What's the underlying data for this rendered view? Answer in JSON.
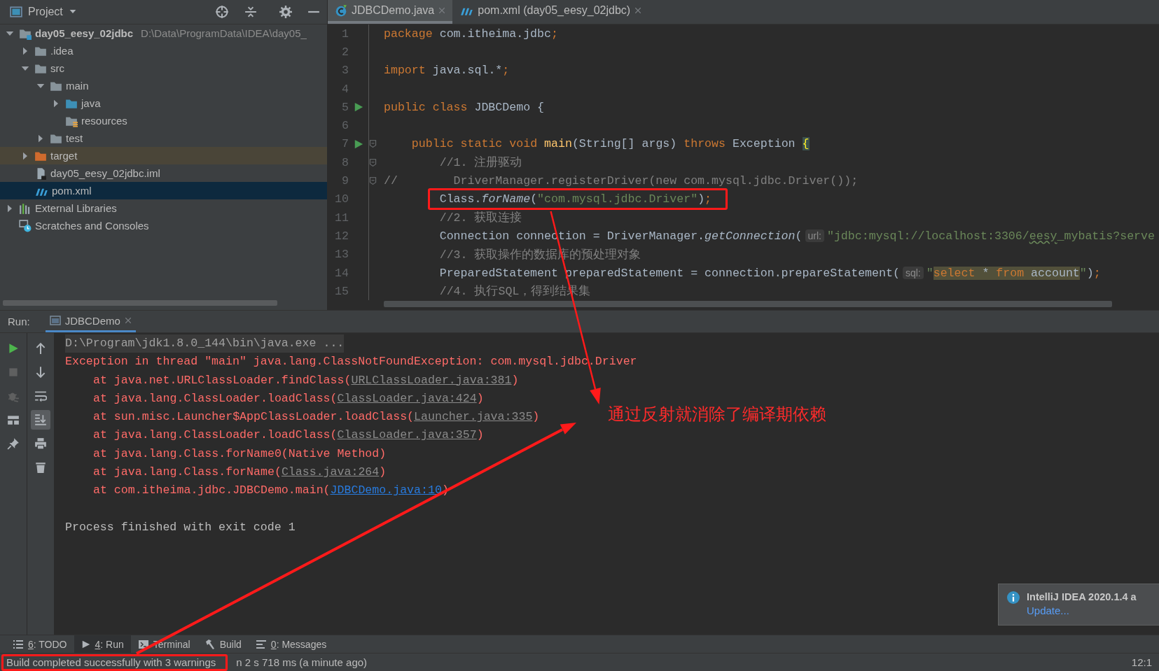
{
  "project_panel": {
    "title": "Project",
    "tree": [
      {
        "name": "day05_eesy_02jdbc",
        "path": "D:\\Data\\ProgramData\\IDEA\\day05_",
        "kind": "module",
        "expanded": true,
        "selected": false,
        "children": [
          {
            "name": ".idea",
            "kind": "folder",
            "expanded": false,
            "selected": false
          },
          {
            "name": "src",
            "kind": "folder",
            "expanded": true,
            "selected": false,
            "children": [
              {
                "name": "main",
                "kind": "folder",
                "expanded": true,
                "selected": false,
                "children": [
                  {
                    "name": "java",
                    "kind": "source-folder",
                    "expanded": false,
                    "selected": false
                  },
                  {
                    "name": "resources",
                    "kind": "resources-folder",
                    "selected": false
                  }
                ]
              },
              {
                "name": "test",
                "kind": "folder",
                "expanded": false,
                "selected": false
              }
            ]
          },
          {
            "name": "target",
            "kind": "excluded-folder",
            "expanded": false,
            "selected": false
          },
          {
            "name": "day05_eesy_02jdbc.iml",
            "kind": "iml-file",
            "selected": false
          },
          {
            "name": "pom.xml",
            "kind": "maven-file",
            "selected": true
          }
        ]
      },
      {
        "name": "External Libraries",
        "kind": "libraries",
        "expanded": false,
        "selected": false
      },
      {
        "name": "Scratches and Consoles",
        "kind": "scratches",
        "selected": false
      }
    ]
  },
  "editor": {
    "tabs": [
      {
        "label": "JDBCDemo.java",
        "kind": "java-class",
        "selected": true
      },
      {
        "label": "pom.xml (day05_eesy_02jdbc)",
        "kind": "maven",
        "selected": false
      }
    ],
    "lines": [
      {
        "number": "1",
        "boxed": false,
        "run_marker": false,
        "fold": false,
        "tokens": [
          {
            "kind": "keyword",
            "text": "package "
          },
          {
            "kind": "plain",
            "text": "com.itheima.jdbc"
          },
          {
            "kind": "keyword",
            "text": ";"
          }
        ]
      },
      {
        "number": "2",
        "boxed": false,
        "run_marker": false,
        "fold": false
      },
      {
        "number": "3",
        "boxed": false,
        "run_marker": false,
        "fold": false,
        "tokens": [
          {
            "kind": "keyword",
            "text": "import "
          },
          {
            "kind": "plain",
            "text": "java.sql.*"
          },
          {
            "kind": "keyword",
            "text": ";"
          }
        ]
      },
      {
        "number": "4",
        "boxed": false,
        "run_marker": false,
        "fold": false
      },
      {
        "number": "5",
        "boxed": false,
        "run_marker": true,
        "fold": false,
        "tokens": [
          {
            "kind": "keyword",
            "text": "public class "
          },
          {
            "kind": "plain",
            "text": "JDBCDemo {"
          }
        ]
      },
      {
        "number": "6",
        "boxed": false,
        "run_marker": false,
        "fold": false
      },
      {
        "number": "7",
        "boxed": false,
        "run_marker": true,
        "fold": true,
        "tokens": [
          {
            "kind": "keyword",
            "text": "    public static void "
          },
          {
            "kind": "method",
            "text": "main"
          },
          {
            "kind": "plain",
            "text": "(String[] args) "
          },
          {
            "kind": "keyword",
            "text": "throws "
          },
          {
            "kind": "plain",
            "text": "Exception "
          },
          {
            "kind": "brace-match",
            "text": "{"
          }
        ]
      },
      {
        "number": "8",
        "boxed": false,
        "run_marker": false,
        "fold": true,
        "tokens": [
          {
            "kind": "comment",
            "text": "        //1. 注册驱动"
          }
        ]
      },
      {
        "number": "9",
        "boxed": false,
        "run_marker": false,
        "fold": true,
        "tokens": [
          {
            "kind": "comment",
            "text": "//        DriverManager.registerDriver(new com.mysql.jdbc.Driver());"
          }
        ]
      },
      {
        "number": "10",
        "boxed": true,
        "run_marker": false,
        "fold": false,
        "tokens": [
          {
            "kind": "plain",
            "text": "        Class."
          },
          {
            "kind": "static-method",
            "text": "forName"
          },
          {
            "kind": "plain",
            "text": "("
          },
          {
            "kind": "string",
            "text": "\"com.mysql.jdbc.Driver\""
          },
          {
            "kind": "plain",
            "text": ")"
          },
          {
            "kind": "keyword",
            "text": ";"
          }
        ]
      },
      {
        "number": "11",
        "boxed": false,
        "run_marker": false,
        "fold": false,
        "tokens": [
          {
            "kind": "comment",
            "text": "        //2. 获取连接"
          }
        ]
      },
      {
        "number": "12",
        "boxed": false,
        "run_marker": false,
        "fold": false,
        "tokens": [
          {
            "kind": "plain",
            "text": "        Connection connection = DriverManager."
          },
          {
            "kind": "static-method",
            "text": "getConnection"
          },
          {
            "kind": "plain",
            "text": "("
          },
          {
            "kind": "hint",
            "text": "url:"
          },
          {
            "kind": "string",
            "text": "\"jdbc:mysql://localhost:3306/"
          },
          {
            "kind": "typo",
            "text": "eesy"
          },
          {
            "kind": "string",
            "text": "_mybatis?serve"
          }
        ]
      },
      {
        "number": "13",
        "boxed": false,
        "run_marker": false,
        "fold": false,
        "tokens": [
          {
            "kind": "comment",
            "text": "        //3. 获取操作的数据库的预处理对象"
          }
        ]
      },
      {
        "number": "14",
        "boxed": false,
        "run_marker": false,
        "fold": false,
        "tokens": [
          {
            "kind": "plain",
            "text": "        PreparedStatement preparedStatement = connection.prepareStatement("
          },
          {
            "kind": "hint",
            "text": "sql:"
          },
          {
            "kind": "string",
            "text": "\""
          },
          {
            "kind": "sql-keyword",
            "text": "select"
          },
          {
            "kind": "sql-text",
            "text": " * "
          },
          {
            "kind": "sql-keyword",
            "text": "from"
          },
          {
            "kind": "sql-text",
            "text": " account"
          },
          {
            "kind": "string",
            "text": "\""
          },
          {
            "kind": "plain",
            "text": ")"
          },
          {
            "kind": "keyword",
            "text": ";"
          }
        ]
      },
      {
        "number": "15",
        "boxed": false,
        "run_marker": false,
        "fold": false,
        "tokens": [
          {
            "kind": "comment",
            "text": "        //4. 执行SQL，得到结果集"
          }
        ]
      }
    ]
  },
  "run_panel": {
    "label": "Run:",
    "tab": {
      "label": "JDBCDemo",
      "selected": true
    },
    "left_toolbar": [
      {
        "kind": "rerun",
        "disabled": false
      },
      {
        "kind": "stop",
        "disabled": true
      },
      {
        "kind": "debug",
        "disabled": true
      },
      {
        "kind": "layout",
        "disabled": false
      },
      {
        "kind": "pin",
        "disabled": false
      }
    ],
    "right_toolbar": [
      {
        "kind": "up",
        "on": false
      },
      {
        "kind": "down",
        "on": false
      },
      {
        "kind": "soft-wrap",
        "on": false
      },
      {
        "kind": "scroll-end",
        "on": true
      },
      {
        "kind": "print",
        "on": false
      },
      {
        "kind": "trash",
        "on": false
      }
    ],
    "console": [
      {
        "kind": "command",
        "text": "D:\\Program\\jdk1.8.0_144\\bin\\java.exe ..."
      },
      {
        "kind": "error",
        "text": "Exception in thread \"main\" java.lang.ClassNotFoundException: com.mysql.jdbc.Driver"
      },
      {
        "kind": "stack",
        "text": "at java.net.URLClassLoader.findClass(",
        "link": {
          "text": "URLClassLoader.java:381",
          "color": "#8a8a8a"
        },
        "end": ")"
      },
      {
        "kind": "stack",
        "text": "at java.lang.ClassLoader.loadClass(",
        "link": {
          "text": "ClassLoader.java:424",
          "color": "#8a8a8a"
        },
        "end": ")"
      },
      {
        "kind": "stack",
        "text": "at sun.misc.Launcher$AppClassLoader.loadClass(",
        "link": {
          "text": "Launcher.java:335",
          "color": "#8a8a8a"
        },
        "end": ")"
      },
      {
        "kind": "stack",
        "text": "at java.lang.ClassLoader.loadClass(",
        "link": {
          "text": "ClassLoader.java:357",
          "color": "#8a8a8a"
        },
        "end": ")"
      },
      {
        "kind": "stack",
        "text": "at java.lang.Class.forName0(Native Method)"
      },
      {
        "kind": "stack",
        "text": "at java.lang.Class.forName(",
        "link": {
          "text": "Class.java:264",
          "color": "#8a8a8a"
        },
        "end": ")"
      },
      {
        "kind": "stack",
        "text": "at com.itheima.jdbc.JDBCDemo.main(",
        "link": {
          "text": "JDBCDemo.java:10",
          "color": "#287bde"
        },
        "end": ")"
      },
      {
        "kind": "blank"
      },
      {
        "kind": "normal",
        "text": "Process finished with exit code 1"
      }
    ]
  },
  "notification": {
    "title": "IntelliJ IDEA 2020.1.4 a",
    "link": "Update..."
  },
  "tool_tabs": [
    {
      "mnemonic": "6",
      "label": ": TODO",
      "kind": "todo",
      "selected": false
    },
    {
      "mnemonic": "4",
      "label": ": Run",
      "kind": "run",
      "selected": true
    },
    {
      "label": "Terminal",
      "kind": "terminal",
      "selected": false
    },
    {
      "label": "Build",
      "kind": "build",
      "selected": false
    },
    {
      "mnemonic": "0",
      "label": ": Messages",
      "kind": "messages",
      "selected": false
    }
  ],
  "status_bar": {
    "boxed": true,
    "message": "Build completed successfully with 3 warnings",
    "message_end": "n 2 s 718 ms (a minute ago)",
    "position": "12:1"
  },
  "annotation": {
    "note": "通过反射就消除了编译期依赖"
  }
}
